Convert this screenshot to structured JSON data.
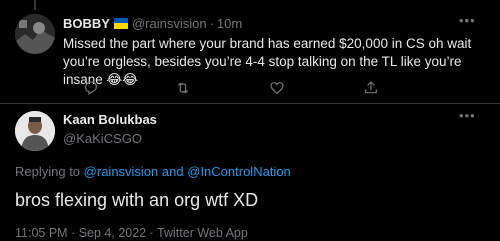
{
  "reply": {
    "author_name": "BOBBY",
    "flag_colors": [
      "#0057b7",
      "#ffd700"
    ],
    "handle": "@rainsvision",
    "separator": "·",
    "time": "10m",
    "text": "Missed the part where your brand has earned $20,000 in CS oh wait you’re orgless, besides you’re 4-4 stop talking on the TL like you’re insane 😂😂",
    "more_icon": "more-icon",
    "actions": [
      "reply-icon",
      "retweet-icon",
      "like-icon",
      "share-icon"
    ]
  },
  "tweet": {
    "author_name": "Kaan Bolukbas",
    "handle": "@KaKiCSGO",
    "replying_prefix": "Replying to",
    "replying_to_1": "@rainsvision",
    "replying_and": "and",
    "replying_to_2": "@InControlNation",
    "text": "bros flexing with an org wtf XD",
    "time": "11:05 PM",
    "sep1": "·",
    "date": "Sep 4, 2022",
    "sep2": "·",
    "source": "Twitter Web App"
  },
  "colors": {
    "background": "#000000",
    "text": "#e7e9ea",
    "muted": "#71767b",
    "link": "#1d9bf0",
    "divider": "#2f3336"
  }
}
